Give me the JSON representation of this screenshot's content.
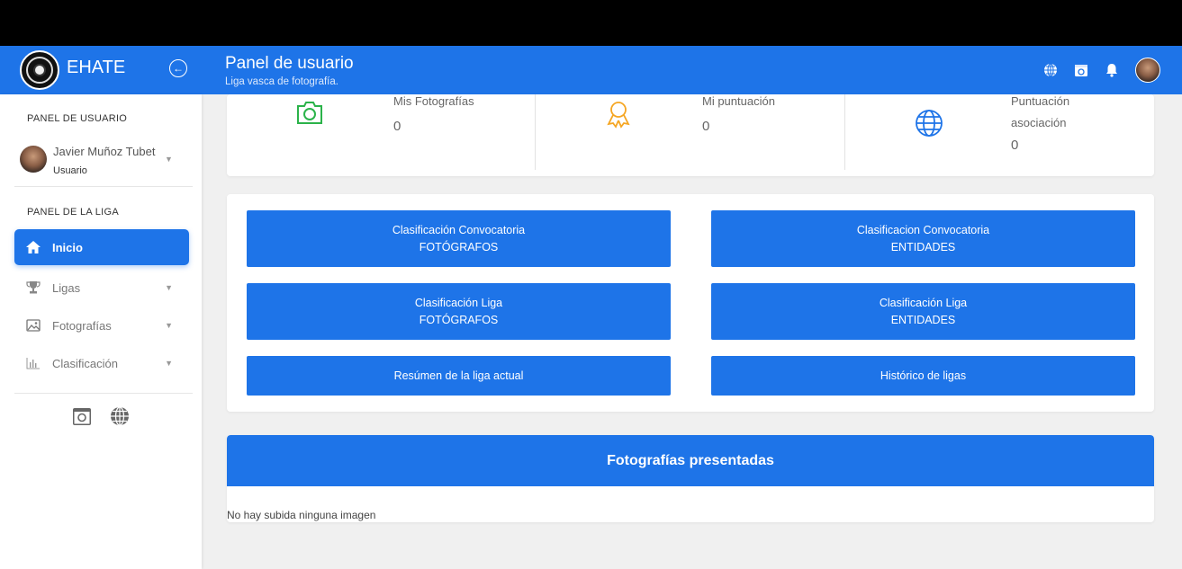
{
  "app": {
    "name": "EHATE",
    "title": "Panel de usuario",
    "subtitle": "Liga vasca de fotografía."
  },
  "colors": {
    "primary": "#1e74e8",
    "photo_icon": "#2bb34a",
    "award_icon": "#f5a623",
    "globe_icon": "#1e74e8"
  },
  "header_icons": [
    "globe-icon",
    "camera-icon",
    "bell-icon",
    "user-avatar"
  ],
  "sidebar": {
    "user_section": "PANEL DE USUARIO",
    "user_name": "Javier Muñoz Tubet",
    "user_role": "Usuario",
    "league_section": "PANEL DE LA LIGA",
    "items": [
      {
        "label": "Inicio",
        "icon": "home-icon",
        "active": true
      },
      {
        "label": "Ligas",
        "icon": "trophy-icon"
      },
      {
        "label": "Fotografías",
        "icon": "images-icon"
      },
      {
        "label": "Clasificación",
        "icon": "bar-chart-icon"
      }
    ],
    "bottom_icons": [
      "camera-icon",
      "globe-icon"
    ]
  },
  "stats": [
    {
      "label": "Mis Fotografías",
      "value": "0",
      "icon": "camera-icon"
    },
    {
      "label": "Mi puntuación",
      "value": "0",
      "icon": "award-icon"
    },
    {
      "label_line1": "Puntuación",
      "label_line2": "asociación",
      "value": "0",
      "icon": "globe-icon"
    }
  ],
  "buttons": {
    "conv_fotografos": {
      "line1": "Clasificación Convocatoria",
      "line2": "FOTÓGRAFOS"
    },
    "conv_entidades": {
      "line1": "Clasificacion Convocatoria",
      "line2": "ENTIDADES"
    },
    "liga_fotografos": {
      "line1": "Clasificación Liga",
      "line2": "FOTÓGRAFOS"
    },
    "liga_entidades": {
      "line1": "Clasificación Liga",
      "line2": "ENTIDADES"
    },
    "resumen": "Resúmen de la liga actual",
    "historico": "Histórico de ligas"
  },
  "photos": {
    "title": "Fotografías presentadas",
    "empty_message": "No hay subida ninguna imagen"
  }
}
